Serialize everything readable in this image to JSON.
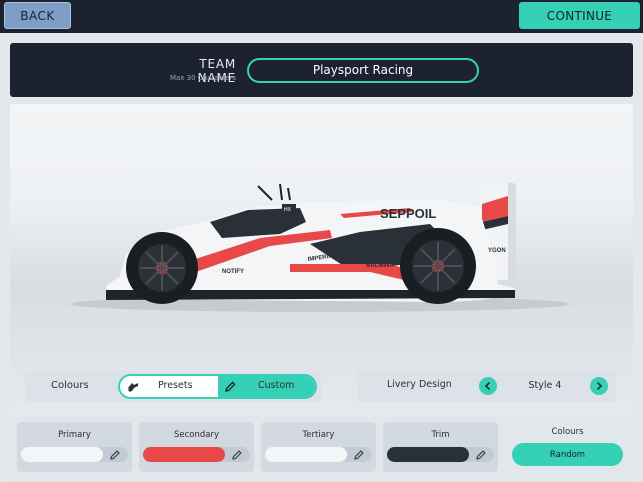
{
  "topbar": {
    "back_label": "BACK",
    "continue_label": "CONTINUE"
  },
  "team": {
    "label": "TEAM NAME",
    "sublabel": "Max 30 Characters",
    "name_value": "Playsport Racing"
  },
  "car": {
    "sponsors": [
      "SEPPOIL",
      "NOTIFY",
      "IMPERIAL",
      "BALMINA",
      "YGON",
      "HX"
    ]
  },
  "colours": {
    "label": "Colours",
    "presets_label": "Presets",
    "custom_label": "Custom",
    "selected": "Custom"
  },
  "livery": {
    "label": "Livery Design",
    "style_label": "Style 4"
  },
  "swatches": [
    {
      "label": "Primary",
      "color": "#f4f5f7"
    },
    {
      "label": "Secondary",
      "color": "#e84848"
    },
    {
      "label": "Tertiary",
      "color": "#f4f5f7"
    },
    {
      "label": "Trim",
      "color": "#2a3038"
    }
  ],
  "random": {
    "title": "Colours",
    "button_label": "Random"
  },
  "theme": {
    "accent": "#35d0b5",
    "dark": "#1c2230",
    "back_button": "#7d9ec6"
  },
  "icons": [
    "preset-car-icon",
    "pencil-icon",
    "chevron-left-icon",
    "chevron-right-icon"
  ]
}
